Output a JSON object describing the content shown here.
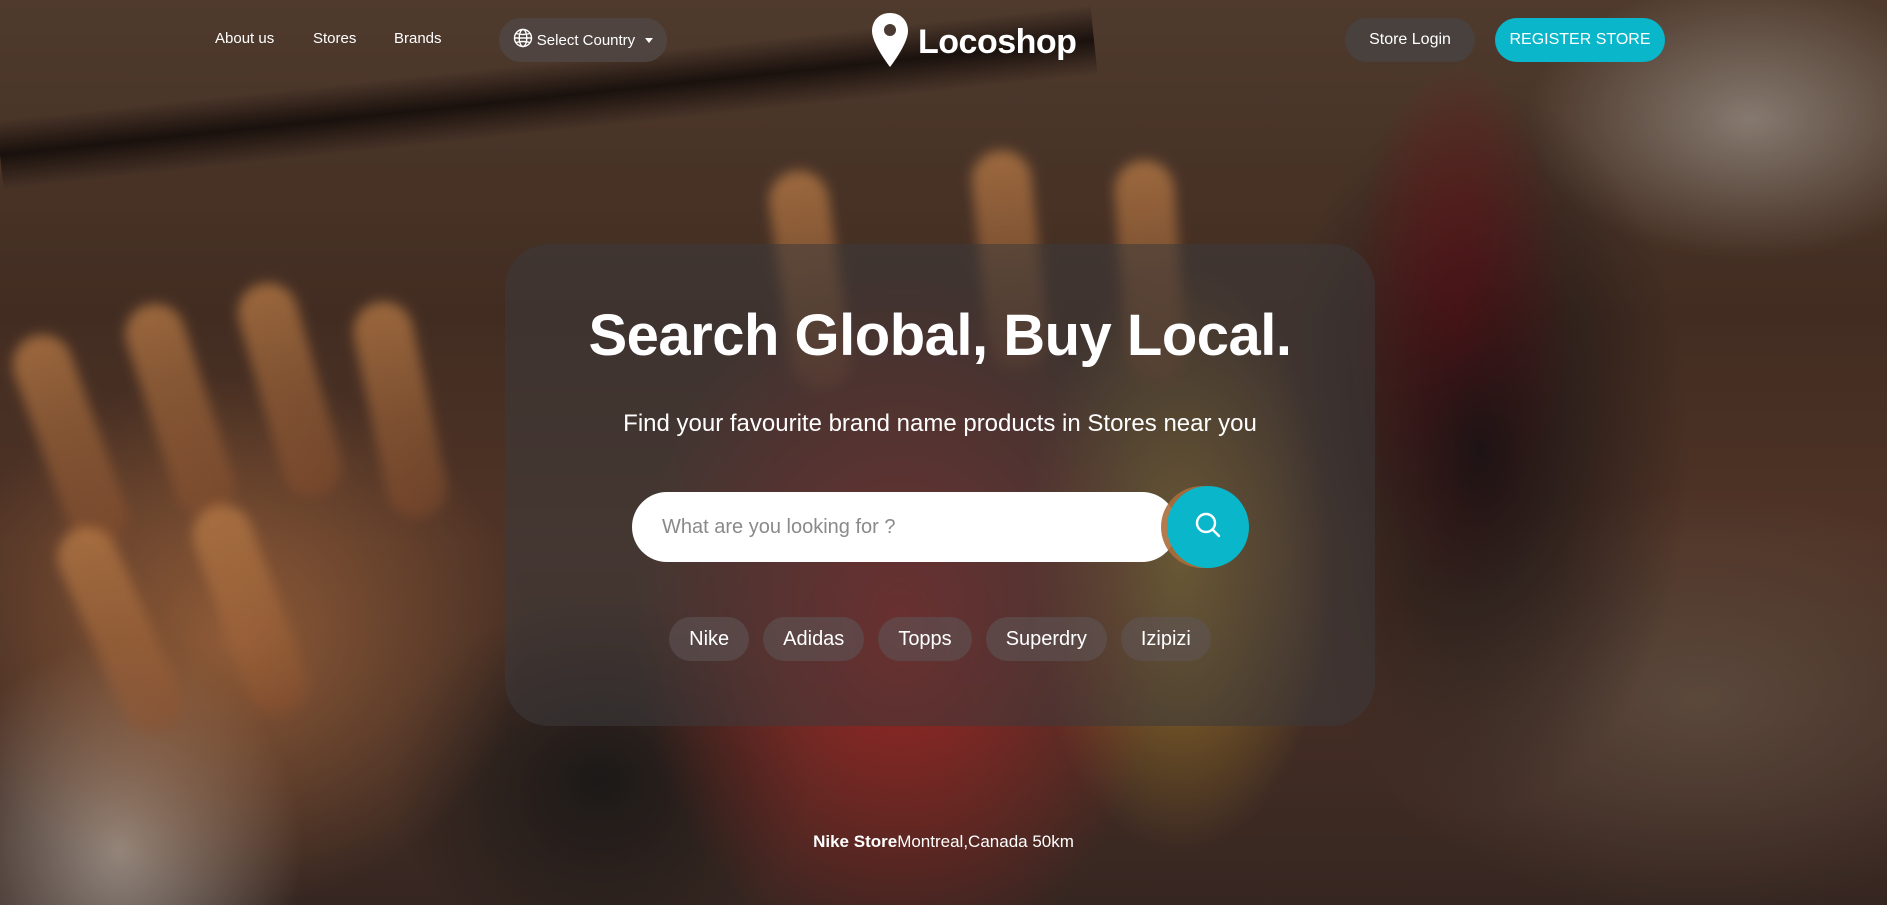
{
  "header": {
    "nav": [
      {
        "label": "About us",
        "name": "nav-about-us"
      },
      {
        "label": "Stores",
        "name": "nav-stores"
      },
      {
        "label": "Brands",
        "name": "nav-brands"
      }
    ],
    "country_select": {
      "label": "Select Country",
      "icon": "globe-icon"
    },
    "logo": {
      "text": "Locoshop",
      "icon": "map-pin-icon"
    },
    "login_label": "Store Login",
    "register_label": "REGISTER STORE"
  },
  "hero": {
    "title": "Search Global, Buy Local.",
    "subtitle": "Find your favourite brand name products in Stores near you",
    "search": {
      "placeholder": "What are you looking for ?",
      "value": "",
      "button_icon": "search-icon"
    },
    "brands": [
      "Nike",
      "Adidas",
      "Topps",
      "Superdry",
      "Izipizi"
    ]
  },
  "featured": {
    "store_name": "Nike Store",
    "location": "Montreal,Canada 50km"
  },
  "colors": {
    "accent": "#0ab6c9",
    "card_background": "rgba(60,58,60,0.55)"
  }
}
